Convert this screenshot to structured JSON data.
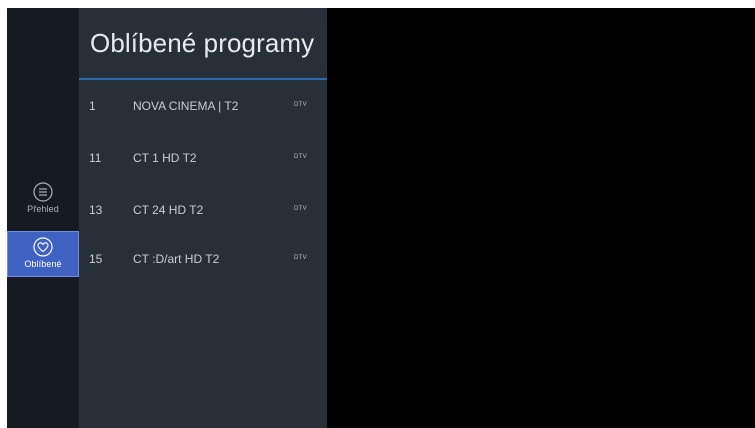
{
  "sidebar": {
    "items": [
      {
        "label": "Přehled",
        "icon": "list-icon",
        "active": false
      },
      {
        "label": "Oblíbené",
        "icon": "heart-icon",
        "active": true
      }
    ]
  },
  "panel": {
    "title": "Oblíbené programy",
    "channels": [
      {
        "number": "1",
        "name": "NOVA CINEMA | T2",
        "badge": "DTV"
      },
      {
        "number": "11",
        "name": "CT 1 HD T2",
        "badge": "DTV"
      },
      {
        "number": "13",
        "name": "CT 24 HD T2",
        "badge": "DTV"
      },
      {
        "number": "15",
        "name": "CT :D/art HD T2",
        "badge": "DTV"
      }
    ]
  },
  "colors": {
    "accent": "#3f62c2",
    "divider": "#2f6aa8",
    "panel_bg": "#273038",
    "rail_bg": "#151b21"
  }
}
